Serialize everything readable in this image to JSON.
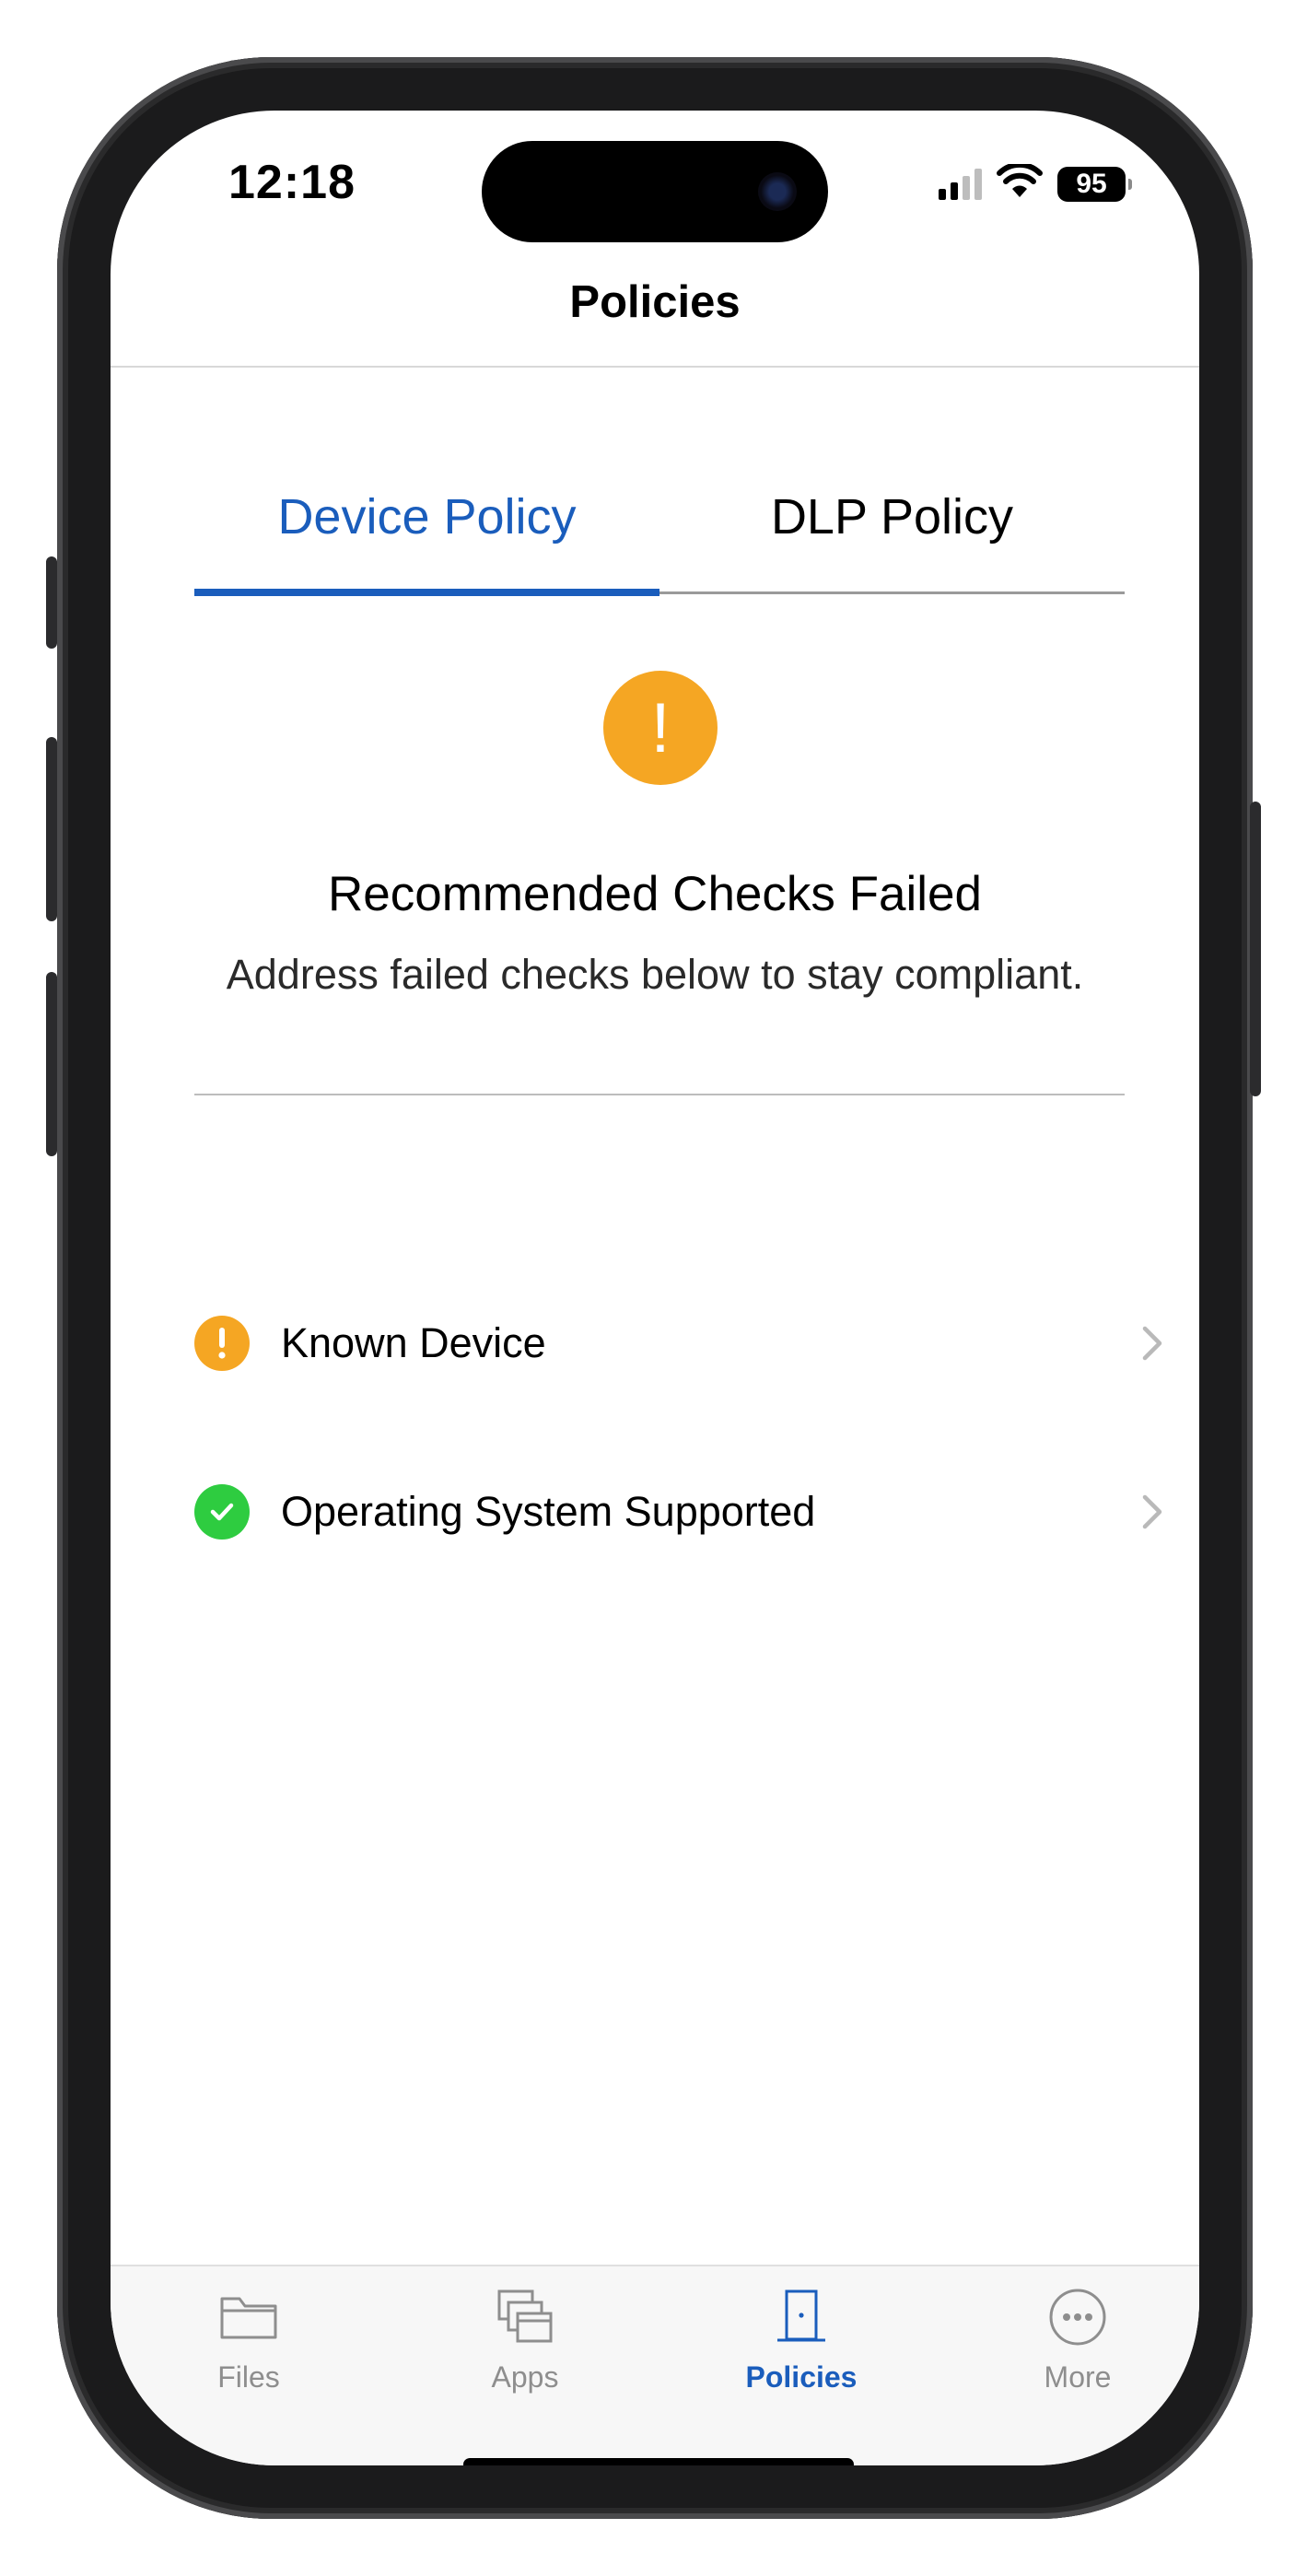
{
  "status_bar": {
    "time": "12:18",
    "battery": "95"
  },
  "nav": {
    "title": "Policies"
  },
  "tabs": [
    {
      "label": "Device Policy",
      "active": true
    },
    {
      "label": "DLP Policy",
      "active": false
    }
  ],
  "summary": {
    "icon": "warning-icon",
    "icon_glyph": "!",
    "headline": "Recommended Checks Failed",
    "subtext": "Address failed checks below to stay compliant."
  },
  "checks": [
    {
      "label": "Known Device",
      "status": "warning",
      "icon": "warning-icon"
    },
    {
      "label": "Operating System Supported",
      "status": "passed",
      "icon": "checkmark-icon"
    }
  ],
  "tabbar": {
    "items": [
      {
        "label": "Files",
        "icon": "folder-icon",
        "active": false
      },
      {
        "label": "Apps",
        "icon": "apps-icon",
        "active": false
      },
      {
        "label": "Policies",
        "icon": "door-icon",
        "active": true
      },
      {
        "label": "More",
        "icon": "more-icon",
        "active": false
      }
    ]
  },
  "colors": {
    "accent": "#1a5dbc",
    "warning": "#f5a623",
    "success": "#2ecc40"
  }
}
